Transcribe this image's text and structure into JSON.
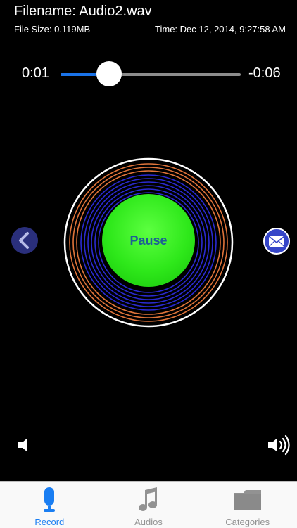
{
  "header": {
    "filename": "Filename: Audio2.wav",
    "file_size": "File Size: 0.119MB",
    "time": "Time: Dec 12, 2014, 9:27:58 AM"
  },
  "player": {
    "current_time": "0:01",
    "remaining_time": "-0:06",
    "progress_fraction": 0.27,
    "pause_label": "Pause"
  },
  "icons": {
    "prev": "chevron-left-icon",
    "mail": "envelope-icon",
    "volume_low": "speaker-icon",
    "volume_high": "speaker-loud-icon",
    "record": "microphone-icon",
    "audios": "music-note-icon",
    "categories": "folder-icon"
  },
  "tabs": [
    {
      "label": "Record",
      "active": true
    },
    {
      "label": "Audios",
      "active": false
    },
    {
      "label": "Categories",
      "active": false
    }
  ],
  "colors": {
    "accent": "#1a7ef2",
    "pause_button": "#2ee81a",
    "tab_inactive": "#929292"
  }
}
